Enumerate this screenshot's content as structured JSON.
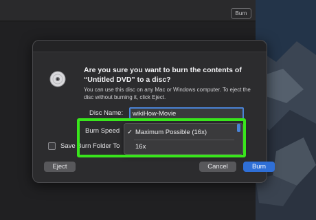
{
  "finder": {
    "burn_button": "Burn"
  },
  "dialog": {
    "title": "Are you sure you want to burn the contents of “Untitled DVD” to a disc?",
    "info": "You can use this disc on any Mac or Windows computer. To eject the disc without burning it, click Eject.",
    "disc_name_label": "Disc Name:",
    "disc_name_value": "wikiHow-Movie",
    "burn_speed_label": "Burn Speed",
    "save_label": "Save Burn Folder To",
    "dropdown": {
      "selected": "Maximum Possible (16x)",
      "check": "✓",
      "other": "16x"
    },
    "buttons": {
      "eject": "Eject",
      "cancel": "Cancel",
      "burn": "Burn"
    }
  },
  "colors": {
    "highlight": "#39e51c",
    "accent": "#2f6fd6"
  }
}
